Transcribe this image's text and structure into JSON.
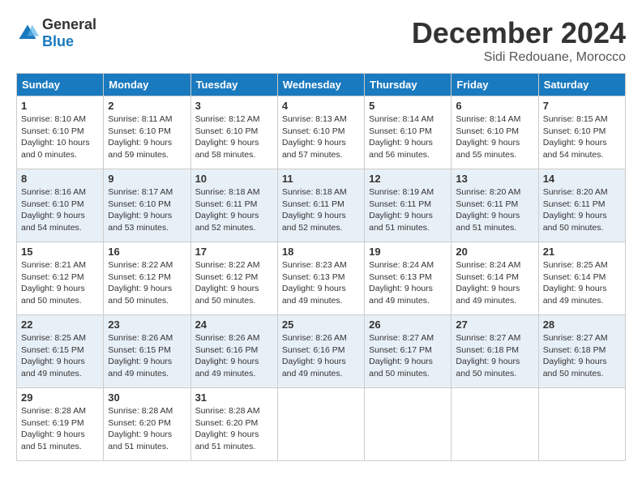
{
  "logo": {
    "general": "General",
    "blue": "Blue"
  },
  "title": "December 2024",
  "location": "Sidi Redouane, Morocco",
  "days_of_week": [
    "Sunday",
    "Monday",
    "Tuesday",
    "Wednesday",
    "Thursday",
    "Friday",
    "Saturday"
  ],
  "weeks": [
    [
      {
        "day": "1",
        "sunrise": "8:10 AM",
        "sunset": "6:10 PM",
        "daylight": "10 hours and 0 minutes."
      },
      {
        "day": "2",
        "sunrise": "8:11 AM",
        "sunset": "6:10 PM",
        "daylight": "9 hours and 59 minutes."
      },
      {
        "day": "3",
        "sunrise": "8:12 AM",
        "sunset": "6:10 PM",
        "daylight": "9 hours and 58 minutes."
      },
      {
        "day": "4",
        "sunrise": "8:13 AM",
        "sunset": "6:10 PM",
        "daylight": "9 hours and 57 minutes."
      },
      {
        "day": "5",
        "sunrise": "8:14 AM",
        "sunset": "6:10 PM",
        "daylight": "9 hours and 56 minutes."
      },
      {
        "day": "6",
        "sunrise": "8:14 AM",
        "sunset": "6:10 PM",
        "daylight": "9 hours and 55 minutes."
      },
      {
        "day": "7",
        "sunrise": "8:15 AM",
        "sunset": "6:10 PM",
        "daylight": "9 hours and 54 minutes."
      }
    ],
    [
      {
        "day": "8",
        "sunrise": "8:16 AM",
        "sunset": "6:10 PM",
        "daylight": "9 hours and 54 minutes."
      },
      {
        "day": "9",
        "sunrise": "8:17 AM",
        "sunset": "6:10 PM",
        "daylight": "9 hours and 53 minutes."
      },
      {
        "day": "10",
        "sunrise": "8:18 AM",
        "sunset": "6:11 PM",
        "daylight": "9 hours and 52 minutes."
      },
      {
        "day": "11",
        "sunrise": "8:18 AM",
        "sunset": "6:11 PM",
        "daylight": "9 hours and 52 minutes."
      },
      {
        "day": "12",
        "sunrise": "8:19 AM",
        "sunset": "6:11 PM",
        "daylight": "9 hours and 51 minutes."
      },
      {
        "day": "13",
        "sunrise": "8:20 AM",
        "sunset": "6:11 PM",
        "daylight": "9 hours and 51 minutes."
      },
      {
        "day": "14",
        "sunrise": "8:20 AM",
        "sunset": "6:11 PM",
        "daylight": "9 hours and 50 minutes."
      }
    ],
    [
      {
        "day": "15",
        "sunrise": "8:21 AM",
        "sunset": "6:12 PM",
        "daylight": "9 hours and 50 minutes."
      },
      {
        "day": "16",
        "sunrise": "8:22 AM",
        "sunset": "6:12 PM",
        "daylight": "9 hours and 50 minutes."
      },
      {
        "day": "17",
        "sunrise": "8:22 AM",
        "sunset": "6:12 PM",
        "daylight": "9 hours and 50 minutes."
      },
      {
        "day": "18",
        "sunrise": "8:23 AM",
        "sunset": "6:13 PM",
        "daylight": "9 hours and 49 minutes."
      },
      {
        "day": "19",
        "sunrise": "8:24 AM",
        "sunset": "6:13 PM",
        "daylight": "9 hours and 49 minutes."
      },
      {
        "day": "20",
        "sunrise": "8:24 AM",
        "sunset": "6:14 PM",
        "daylight": "9 hours and 49 minutes."
      },
      {
        "day": "21",
        "sunrise": "8:25 AM",
        "sunset": "6:14 PM",
        "daylight": "9 hours and 49 minutes."
      }
    ],
    [
      {
        "day": "22",
        "sunrise": "8:25 AM",
        "sunset": "6:15 PM",
        "daylight": "9 hours and 49 minutes."
      },
      {
        "day": "23",
        "sunrise": "8:26 AM",
        "sunset": "6:15 PM",
        "daylight": "9 hours and 49 minutes."
      },
      {
        "day": "24",
        "sunrise": "8:26 AM",
        "sunset": "6:16 PM",
        "daylight": "9 hours and 49 minutes."
      },
      {
        "day": "25",
        "sunrise": "8:26 AM",
        "sunset": "6:16 PM",
        "daylight": "9 hours and 49 minutes."
      },
      {
        "day": "26",
        "sunrise": "8:27 AM",
        "sunset": "6:17 PM",
        "daylight": "9 hours and 50 minutes."
      },
      {
        "day": "27",
        "sunrise": "8:27 AM",
        "sunset": "6:18 PM",
        "daylight": "9 hours and 50 minutes."
      },
      {
        "day": "28",
        "sunrise": "8:27 AM",
        "sunset": "6:18 PM",
        "daylight": "9 hours and 50 minutes."
      }
    ],
    [
      {
        "day": "29",
        "sunrise": "8:28 AM",
        "sunset": "6:19 PM",
        "daylight": "9 hours and 51 minutes."
      },
      {
        "day": "30",
        "sunrise": "8:28 AM",
        "sunset": "6:20 PM",
        "daylight": "9 hours and 51 minutes."
      },
      {
        "day": "31",
        "sunrise": "8:28 AM",
        "sunset": "6:20 PM",
        "daylight": "9 hours and 51 minutes."
      },
      null,
      null,
      null,
      null
    ]
  ]
}
